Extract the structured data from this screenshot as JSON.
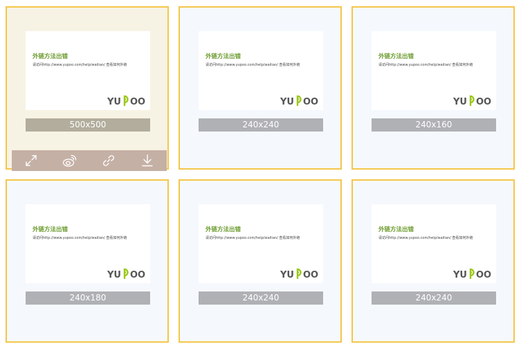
{
  "thumbnail": {
    "title": "外链方法出错",
    "text": "请访问http://www.yupoo.com/help/wailian/ 查看如何外链",
    "logo_text": "YUPOO"
  },
  "cards": [
    {
      "size_label": "500x500",
      "selected": true
    },
    {
      "size_label": "240x240",
      "selected": false
    },
    {
      "size_label": "240x160",
      "selected": false
    },
    {
      "size_label": "240x180",
      "selected": false
    },
    {
      "size_label": "240x240",
      "selected": false
    },
    {
      "size_label": "240x240",
      "selected": false
    }
  ],
  "actions": [
    {
      "icon": "expand-icon"
    },
    {
      "icon": "weibo-icon"
    },
    {
      "icon": "link-icon"
    },
    {
      "icon": "download-icon"
    }
  ],
  "colors": {
    "card_border": "#f4c64a",
    "card_bg": "#f5f8fd",
    "card_bg_selected": "#f7f3e4",
    "size_bar": "#b0b1b5",
    "size_bar_selected": "#b2ad9c",
    "action_bar": "#c5b0a5",
    "thumb_title": "#6a9a2c",
    "logo_text": "#555555",
    "logo_accent": "#9bc81c"
  }
}
